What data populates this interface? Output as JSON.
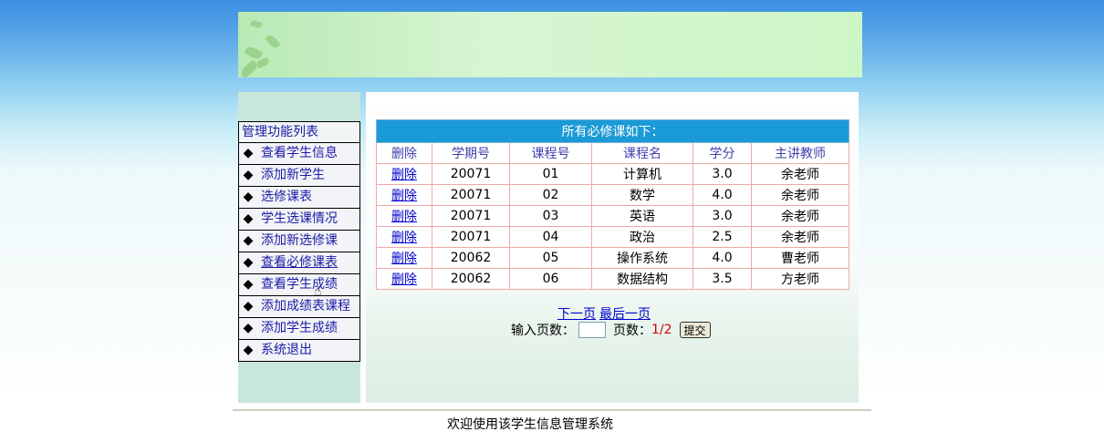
{
  "menu": {
    "title": "管理功能列表",
    "bullet": "◆",
    "items": [
      {
        "label": "查看学生信息"
      },
      {
        "label": "添加新学生"
      },
      {
        "label": "选修课表"
      },
      {
        "label": "学生选课情况"
      },
      {
        "label": "添加新选修课"
      },
      {
        "label": "查看必修课表"
      },
      {
        "label": "查看学生成绩"
      },
      {
        "label": "添加成绩表课程"
      },
      {
        "label": "添加学生成绩"
      },
      {
        "label": "系统退出"
      }
    ]
  },
  "table": {
    "caption": "所有必修课如下：",
    "headers": [
      "删除",
      "学期号",
      "课程号",
      "课程名",
      "学分",
      "主讲教师"
    ],
    "rows": [
      {
        "del": "删除",
        "term": "20071",
        "course_no": "01",
        "course_name": "计算机",
        "credit": "3.0",
        "teacher": "余老师"
      },
      {
        "del": "删除",
        "term": "20071",
        "course_no": "02",
        "course_name": "数学",
        "credit": "4.0",
        "teacher": "余老师"
      },
      {
        "del": "删除",
        "term": "20071",
        "course_no": "03",
        "course_name": "英语",
        "credit": "3.0",
        "teacher": "余老师"
      },
      {
        "del": "删除",
        "term": "20071",
        "course_no": "04",
        "course_name": "政治",
        "credit": "2.5",
        "teacher": "余老师"
      },
      {
        "del": "删除",
        "term": "20062",
        "course_no": "05",
        "course_name": "操作系统",
        "credit": "4.0",
        "teacher": "曹老师"
      },
      {
        "del": "删除",
        "term": "20062",
        "course_no": "06",
        "course_name": "数据结构",
        "credit": "3.5",
        "teacher": "方老师"
      }
    ]
  },
  "pager": {
    "next": "下一页",
    "last": "最后一页",
    "input_label": "输入页数：",
    "input_value": "",
    "pages_label": "页数：",
    "pages_value": "1/2",
    "submit": "提交"
  },
  "footer": {
    "text": "欢迎使用该学生信息管理系统"
  },
  "colors": {
    "caption_bg": "#1a9ad6",
    "link": "#0000cc",
    "border": "#f0a8a8"
  }
}
